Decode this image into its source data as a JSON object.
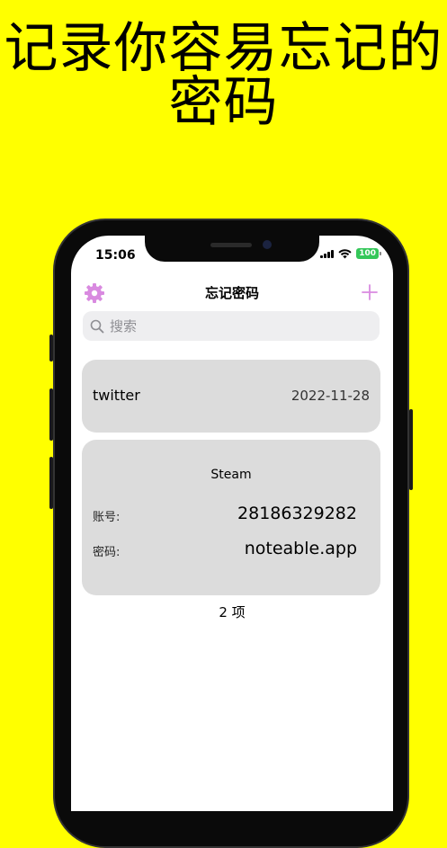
{
  "banner": {
    "line1": "记录你容易忘记的",
    "line2": "密码"
  },
  "status_bar": {
    "time": "15:06",
    "battery": "100"
  },
  "nav": {
    "title": "忘记密码",
    "settings_icon": "gear-icon",
    "add_icon": "plus-icon"
  },
  "search": {
    "placeholder": "搜索"
  },
  "entries": [
    {
      "name": "twitter",
      "date": "2022-11-28"
    },
    {
      "name": "Steam",
      "account_label": "账号:",
      "account": "28186329282",
      "password_label": "密码:",
      "password": "noteable.app"
    }
  ],
  "footer": {
    "count": "2 项"
  },
  "colors": {
    "background": "#FFFF00",
    "accent": "#D98AE0",
    "card": "#DCDCDC",
    "battery": "#34C759"
  }
}
